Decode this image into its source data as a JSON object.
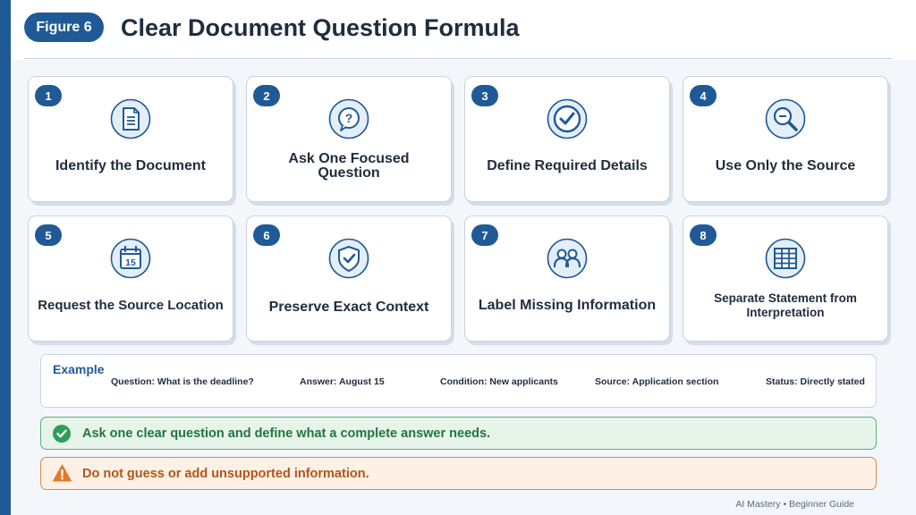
{
  "figure_label": "Figure 6",
  "title": "Clear Document Question Formula",
  "steps": [
    {
      "number": "1",
      "label": "Identify the Document",
      "icon": "document-icon"
    },
    {
      "number": "2",
      "label": "Ask One Focused Question",
      "icon": "question-bubble-icon"
    },
    {
      "number": "3",
      "label": "Define Required Details",
      "icon": "checkmark-circle-icon"
    },
    {
      "number": "4",
      "label": "Use Only the Source",
      "icon": "magnifier-icon"
    },
    {
      "number": "5",
      "label": "Request the Source Location",
      "icon": "calendar-icon",
      "icon_text": "15"
    },
    {
      "number": "6",
      "label": "Preserve Exact Context",
      "icon": "shield-check-icon"
    },
    {
      "number": "7",
      "label": "Label Missing Information",
      "icon": "people-icon"
    },
    {
      "number": "8",
      "label": "Separate Statement from Interpretation",
      "icon": "table-grid-icon"
    }
  ],
  "example": {
    "title": "Example",
    "items": [
      "Question: What is the deadline?",
      "Answer: August 15",
      "Condition: New applicants",
      "Source: Application section",
      "Status: Directly stated"
    ]
  },
  "tip": {
    "text": "Ask one clear question and define what a complete answer needs.",
    "icon": "check-circle-icon",
    "color": "#2e9e57"
  },
  "warning": {
    "text": "Do not guess or add unsupported information.",
    "icon": "warning-triangle-icon",
    "color": "#e07b2c"
  },
  "footer": "AI Mastery • Beginner Guide",
  "colors": {
    "accent": "#1f5a96",
    "icon_fill": "#e4eef8"
  }
}
